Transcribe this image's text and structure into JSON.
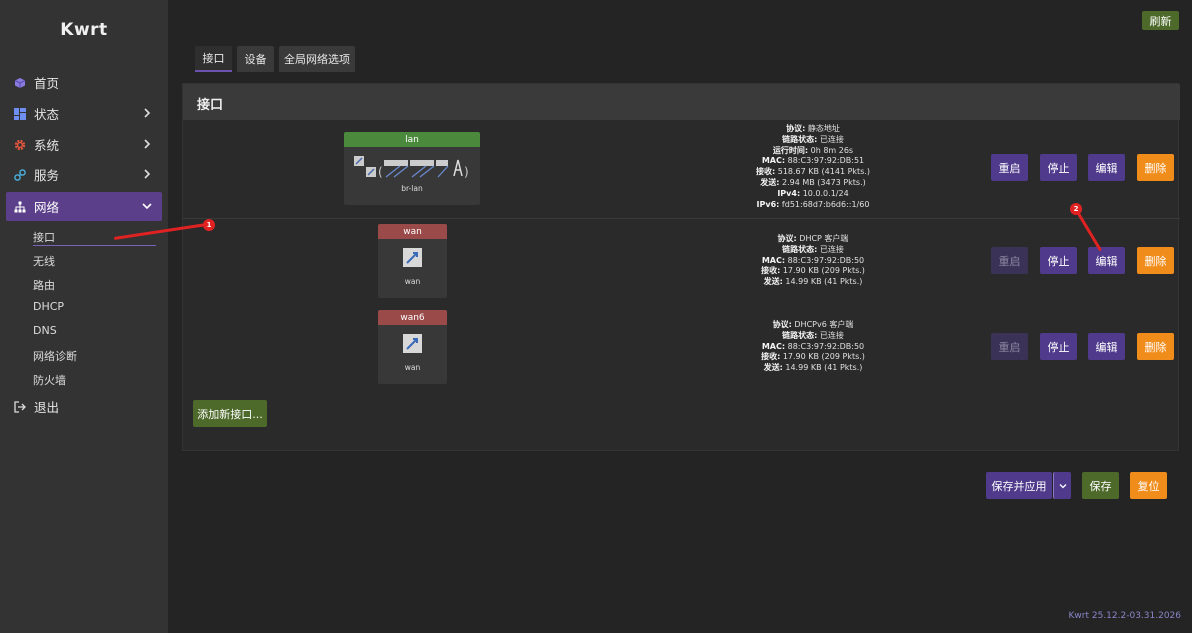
{
  "app": {
    "logo": "Kwrt",
    "version": "Kwrt 25.12.2-03.31.2026"
  },
  "sidebar": {
    "items": [
      {
        "label": "首页",
        "icon": "cube-icon"
      },
      {
        "label": "状态",
        "icon": "dashboard-icon"
      },
      {
        "label": "系统",
        "icon": "gear-icon"
      },
      {
        "label": "服务",
        "icon": "puzzle-icon"
      },
      {
        "label": "网络",
        "icon": "network-icon"
      },
      {
        "label": "退出",
        "icon": "logout-icon"
      }
    ],
    "network_sub": [
      "接口",
      "无线",
      "路由",
      "DHCP",
      "DNS",
      "网络诊断",
      "防火墙"
    ]
  },
  "header": {
    "refresh_label": "刷新"
  },
  "tabs": [
    "接口",
    "设备",
    "全局网络选项"
  ],
  "panel": {
    "title": "接口"
  },
  "interfaces": [
    {
      "name": "lan",
      "device": "br-lan",
      "header_color": "#4b8a3d",
      "info": [
        [
          "协议:",
          "静态地址"
        ],
        [
          "链路状态:",
          "已连接"
        ],
        [
          "运行时间:",
          "0h 8m 26s"
        ],
        [
          "MAC:",
          "88:C3:97:92:DB:51"
        ],
        [
          "接收:",
          "518.67 KB (4141 Pkts.)"
        ],
        [
          "发送:",
          "2.94 MB (3473 Pkts.)"
        ],
        [
          "IPv4:",
          "10.0.0.1/24"
        ],
        [
          "IPv6:",
          "fd51:68d7:b6d6::1/60"
        ]
      ]
    },
    {
      "name": "wan",
      "device": "wan",
      "header_color": "#9b4a4a",
      "info": [
        [
          "协议:",
          "DHCP 客户端"
        ],
        [
          "链路状态:",
          "已连接"
        ],
        [
          "MAC:",
          "88:C3:97:92:DB:50"
        ],
        [
          "接收:",
          "17.90 KB (209 Pkts.)"
        ],
        [
          "发送:",
          "14.99 KB (41 Pkts.)"
        ]
      ]
    },
    {
      "name": "wan6",
      "device": "wan",
      "header_color": "#9b4a4a",
      "info": [
        [
          "协议:",
          "DHCPv6 客户端"
        ],
        [
          "链路状态:",
          "已连接"
        ],
        [
          "MAC:",
          "88:C3:97:92:DB:50"
        ],
        [
          "接收:",
          "17.90 KB (209 Pkts.)"
        ],
        [
          "发送:",
          "14.99 KB (41 Pkts.)"
        ]
      ]
    }
  ],
  "row_actions": {
    "restart": "重启",
    "stop": "停止",
    "edit": "编辑",
    "delete": "删除"
  },
  "add_interface_label": "添加新接口...",
  "footer_actions": {
    "save_apply": "保存并应用",
    "save": "保存",
    "reset": "复位"
  },
  "annotations": [
    "1",
    "2"
  ],
  "colors": {
    "accent": "#5b3f8a",
    "green": "#4d6a2b",
    "orange": "#f08c1a",
    "marker": "#e12222"
  }
}
